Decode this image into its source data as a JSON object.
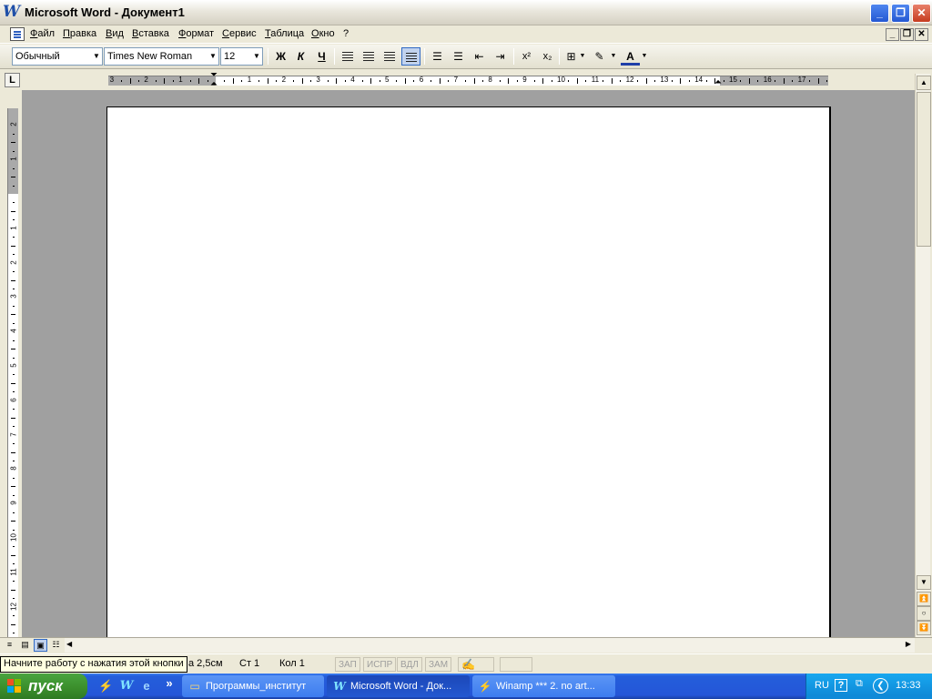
{
  "window": {
    "title": "Microsoft Word - Документ1",
    "logo_letter": "W",
    "minimize": "_",
    "restore": "❐",
    "close": "✕"
  },
  "menu": {
    "items": [
      "Файл",
      "Правка",
      "Вид",
      "Вставка",
      "Формат",
      "Сервис",
      "Таблица",
      "Окно",
      "?"
    ],
    "doc_minimize": "_",
    "doc_restore": "❐",
    "doc_close": "✕"
  },
  "toolbar": {
    "style": "Обычный",
    "font": "Times New Roman",
    "size": "12",
    "bold": "Ж",
    "italic": "К",
    "underline": "Ч",
    "superscript": "x²",
    "subscript": "x₂",
    "font_color_letter": "A"
  },
  "ruler": {
    "h_labels": [
      "3",
      "2",
      "1",
      "1",
      "2",
      "3",
      "4",
      "5",
      "6",
      "7",
      "8",
      "9",
      "10",
      "11",
      "12",
      "13",
      "14",
      "15",
      "16",
      "17"
    ],
    "v_labels": [
      "2",
      "1",
      "1",
      "2",
      "3",
      "4",
      "5",
      "6",
      "7",
      "8",
      "9",
      "10",
      "11",
      "12"
    ],
    "tab_selector": "L"
  },
  "status": {
    "position": "а 2,5см",
    "line": "Ст 1",
    "column": "Кол 1",
    "modes": [
      "ЗАП",
      "ИСПР",
      "ВДЛ",
      "ЗАМ"
    ]
  },
  "tooltip": "Начните работу с нажатия этой кнопки",
  "taskbar": {
    "start_label": "пуск",
    "tasks": [
      {
        "label": "Программы_институт",
        "icon": "folder-icon"
      },
      {
        "label": "Microsoft Word - Док...",
        "icon": "word-icon"
      },
      {
        "label": "Winamp *** 2. no art...",
        "icon": "winamp-icon"
      }
    ],
    "tray": {
      "language": "RU",
      "time": "13:33",
      "help": "?"
    }
  },
  "colors": {
    "taskbar_blue": "#245edb",
    "start_green": "#3b8f2c",
    "desk_gray": "#a0a0a0",
    "tooltip_bg": "#ffffe1"
  }
}
